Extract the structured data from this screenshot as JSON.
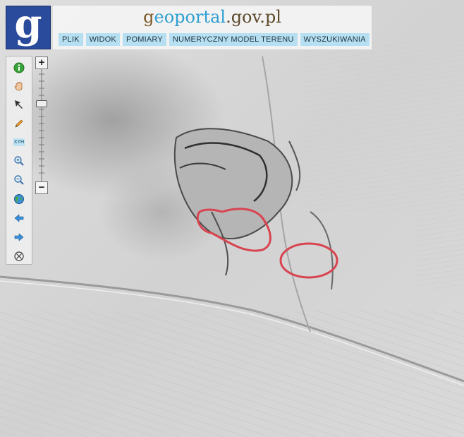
{
  "logo": {
    "letter": "g"
  },
  "header": {
    "title_parts": {
      "g": "g",
      "portal": "eoportal",
      "domain": ".gov.pl"
    },
    "menu": [
      "PLIK",
      "WIDOK",
      "POMIARY",
      "NUMERYCZNY MODEL TERENU",
      "WYSZUKIWANIA"
    ]
  },
  "toolbar": {
    "tools": [
      "info-icon",
      "pan-hand-icon",
      "select-arrow-icon",
      "pencil-icon",
      "xyh-icon",
      "zoom-in-icon",
      "zoom-out-icon",
      "globe-icon",
      "back-arrow-icon",
      "forward-arrow-icon",
      "clear-icon"
    ],
    "xyh_label": "XYH"
  },
  "zoom": {
    "plus_label": "+",
    "minus_label": "−"
  },
  "colors": {
    "logo_bg": "#2a4a9c",
    "menu_bg": "#b6dff1",
    "highlight": "#d8444f"
  }
}
